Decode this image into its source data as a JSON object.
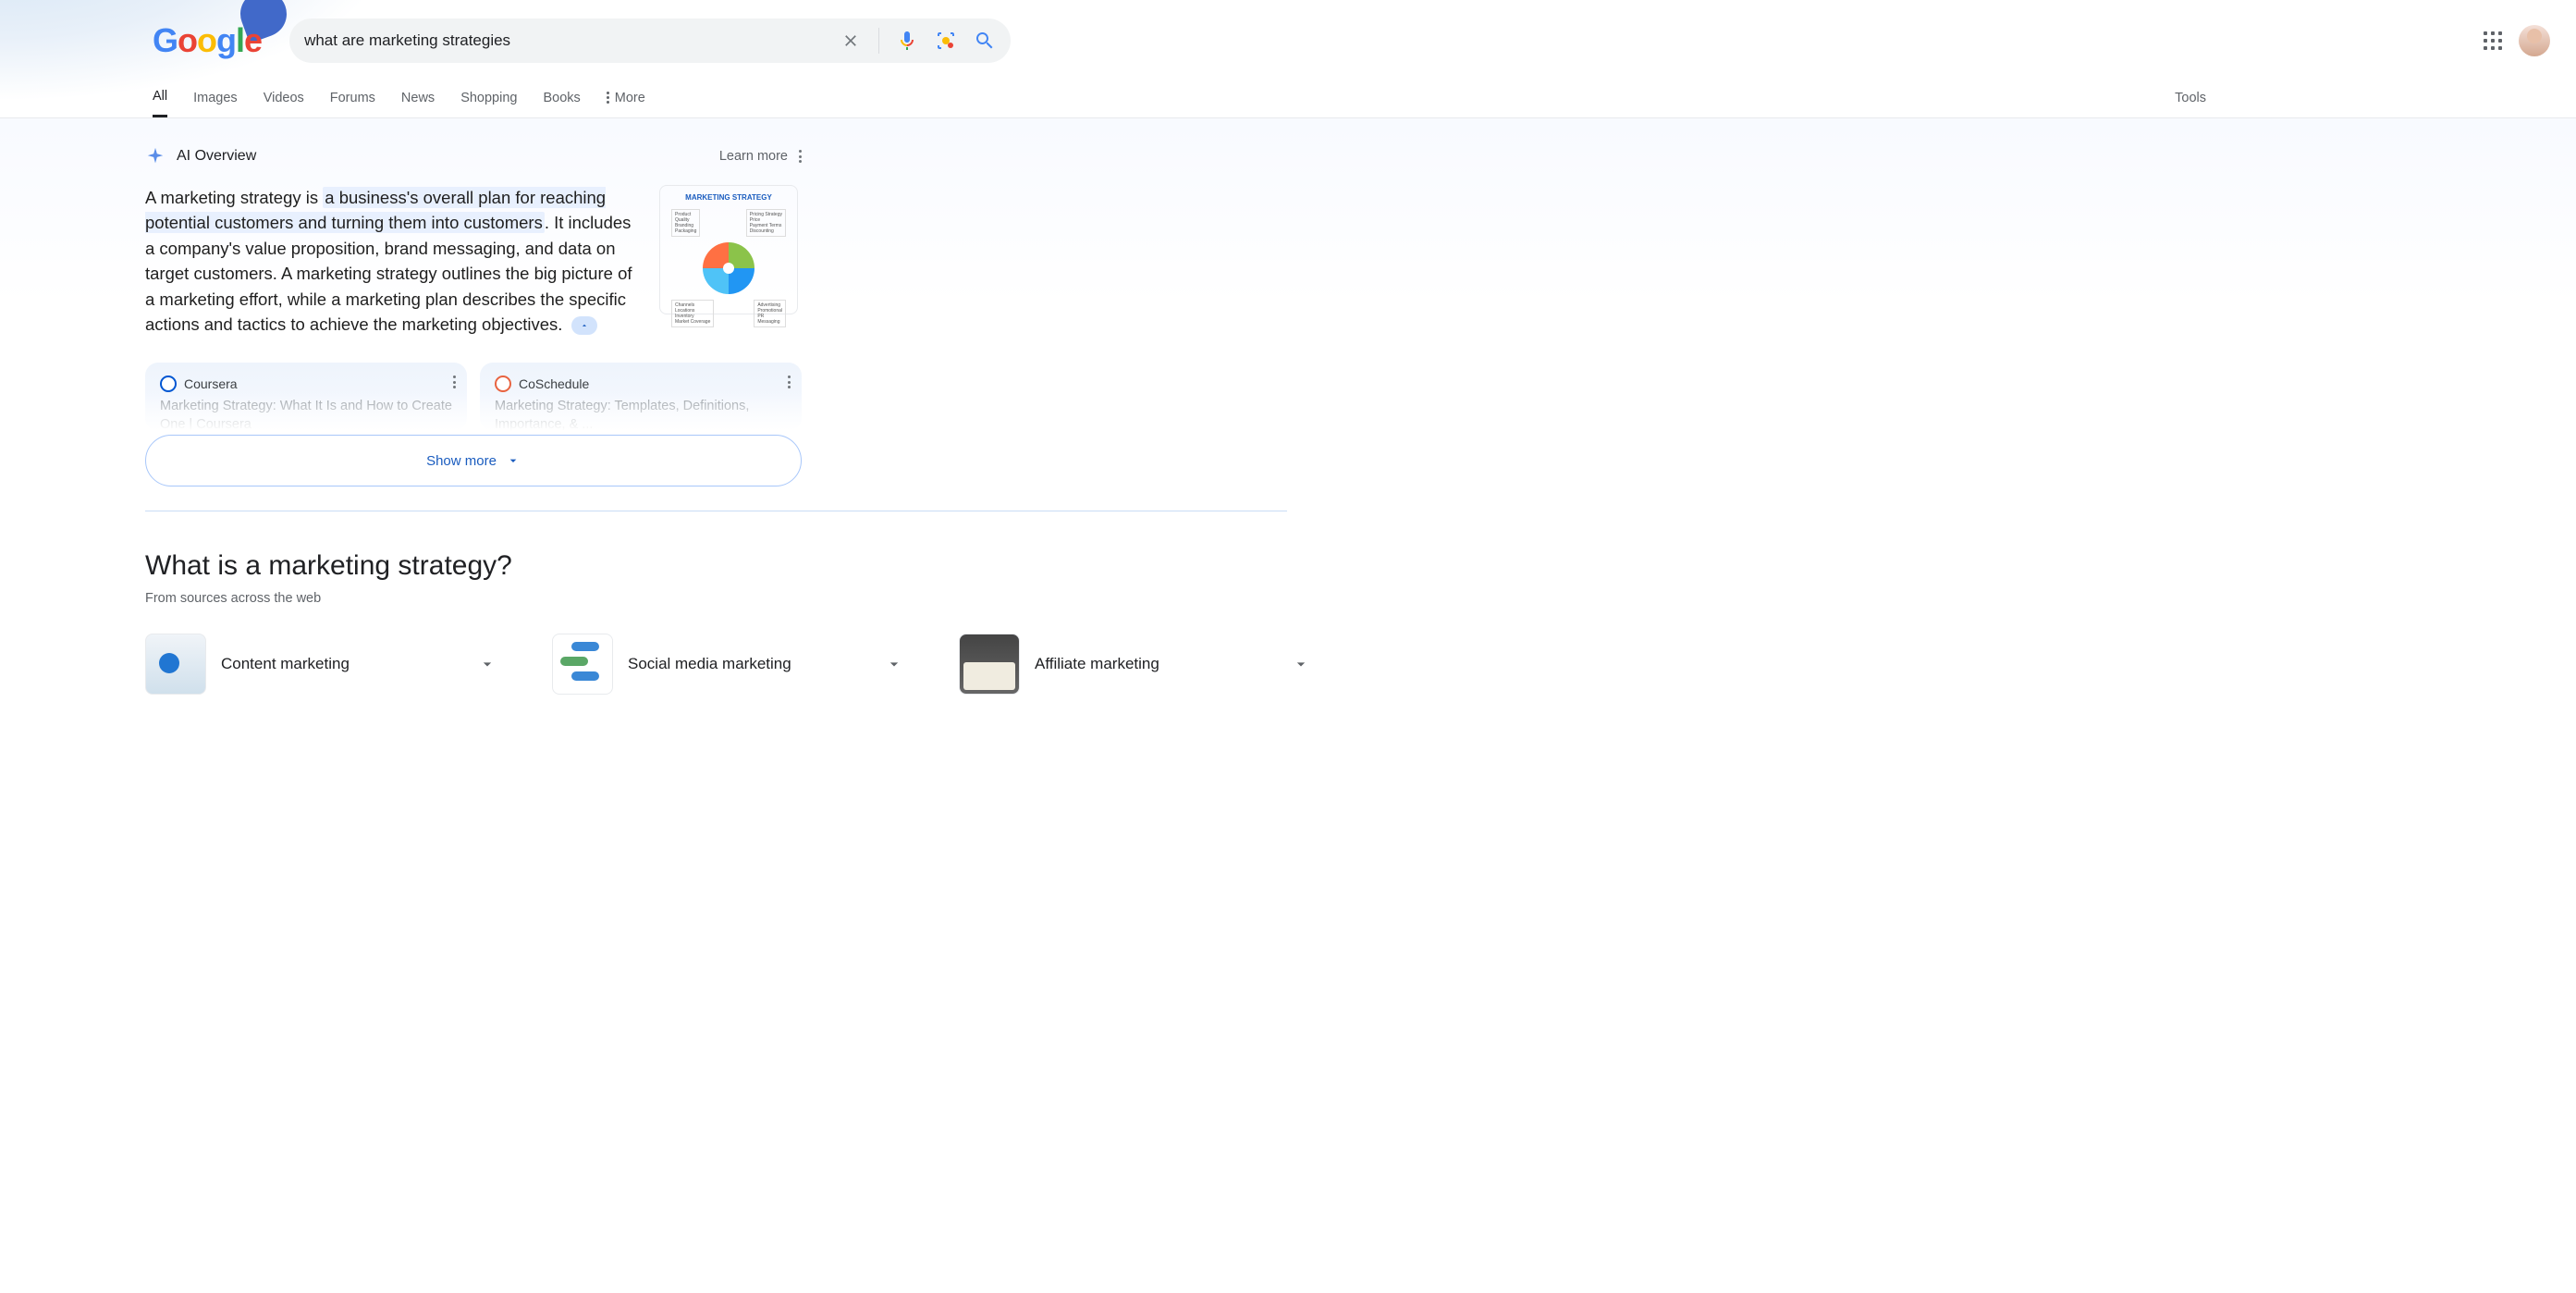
{
  "search": {
    "query": "what are marketing strategies"
  },
  "tabs": {
    "all": "All",
    "images": "Images",
    "videos": "Videos",
    "forums": "Forums",
    "news": "News",
    "shopping": "Shopping",
    "books": "Books",
    "more": "More",
    "tools": "Tools"
  },
  "ai": {
    "title": "AI Overview",
    "learn_more": "Learn more",
    "text_prefix": "A marketing strategy is ",
    "text_highlight": "a business's overall plan for reaching potential customers and turning them into customers",
    "text_suffix": ". It includes a company's value proposition, brand messaging, and data on target customers. A marketing strategy outlines the big picture of a marketing effort, while a marketing plan describes the specific actions and tactics to achieve the marketing objectives.",
    "thumb_title": "MARKETING STRATEGY",
    "show_more": "Show more",
    "sources": [
      {
        "name": "Coursera",
        "icon_color": "#0056d2",
        "snippet": "Marketing Strategy: What It Is and How to Create One | Coursera"
      },
      {
        "name": "CoSchedule",
        "icon_color": "#e86340",
        "snippet": "Marketing Strategy: Templates, Definitions, Importance, & ..."
      }
    ]
  },
  "section": {
    "title": "What is a marketing strategy?",
    "subtitle": "From sources across the web"
  },
  "related": [
    {
      "label": "Content marketing"
    },
    {
      "label": "Social media marketing"
    },
    {
      "label": "Affiliate marketing"
    }
  ]
}
